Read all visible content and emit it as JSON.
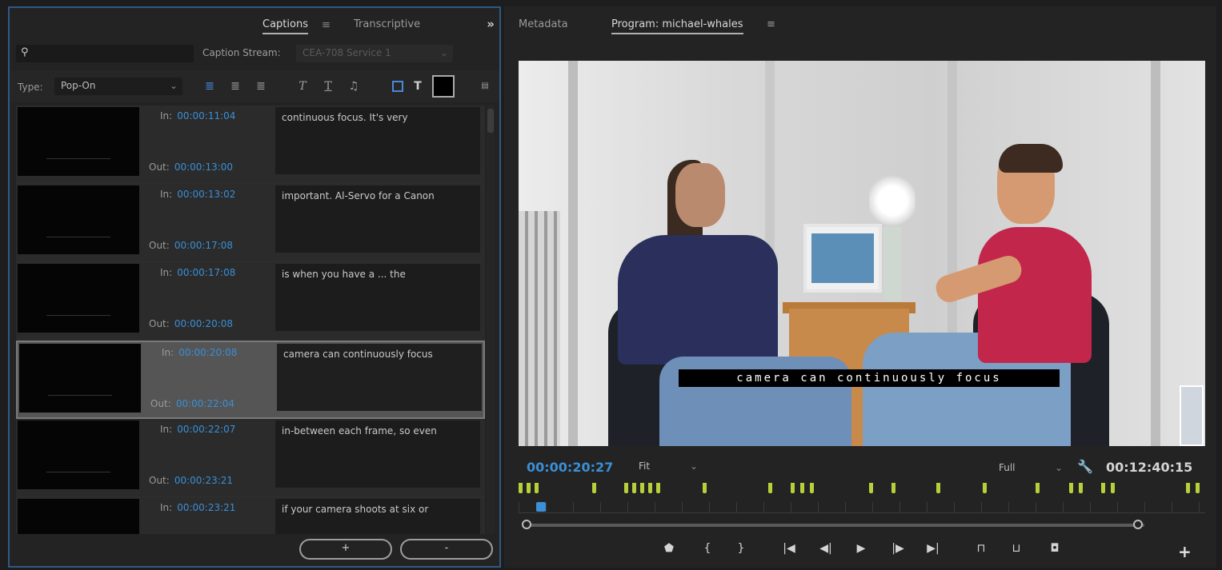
{
  "left_panel": {
    "tabs": [
      {
        "label": "Captions",
        "active": true
      },
      {
        "label": "Transcriptive",
        "active": false
      }
    ],
    "tab_menu_icon": "hamburger-icon",
    "collapse_icon": "double-chevron-right-icon",
    "search": {
      "placeholder": ""
    },
    "caption_stream_label": "Caption Stream:",
    "caption_stream_value": "CEA-708 Service 1",
    "type_label": "Type:",
    "type_value": "Pop-On",
    "toolbar_icons": [
      "align-left-icon",
      "align-center-icon",
      "align-right-icon",
      "italic-icon",
      "underline-icon",
      "music-note-icon",
      "background-color-icon",
      "text-color-icon",
      "color-swatch",
      "safe-margins-icon"
    ],
    "text_style_glyphs": {
      "italic": "T",
      "underline": "T",
      "text_color": "T"
    },
    "swatch_color": "#000000",
    "captions": [
      {
        "in_label": "In:",
        "in": "00:00:11:04",
        "out_label": "Out:",
        "out": "00:00:13:00",
        "text": "continuous focus. It's very",
        "selected": false
      },
      {
        "in_label": "In:",
        "in": "00:00:13:02",
        "out_label": "Out:",
        "out": "00:00:17:08",
        "text": "important. Al-Servo for a Canon",
        "selected": false
      },
      {
        "in_label": "In:",
        "in": "00:00:17:08",
        "out_label": "Out:",
        "out": "00:00:20:08",
        "text": "is when you have a ... the",
        "selected": false
      },
      {
        "in_label": "In:",
        "in": "00:00:20:08",
        "out_label": "Out:",
        "out": "00:00:22:04",
        "text": "camera can continuously focus",
        "selected": true
      },
      {
        "in_label": "In:",
        "in": "00:00:22:07",
        "out_label": "Out:",
        "out": "00:00:23:21",
        "text": "in-between each frame, so even",
        "selected": false
      },
      {
        "in_label": "In:",
        "in": "00:00:23:21",
        "out_label": "Out:",
        "out": "",
        "text": "if your camera shoots at six or",
        "selected": false
      }
    ],
    "add_button": "+",
    "remove_button": "-"
  },
  "right_panel": {
    "tabs": [
      {
        "label": "Metadata",
        "active": false
      },
      {
        "label": "Program: michael-whales",
        "active": true
      }
    ],
    "tab_menu_icon": "hamburger-icon",
    "caption_overlay": "camera can continuously focus",
    "current_timecode": "00:00:20:27",
    "fit_value": "Fit",
    "resolution_value": "Full",
    "wrench_icon": "wrench-icon",
    "duration_timecode": "00:12:40:15",
    "controls": [
      "marker-icon",
      "mark-in-icon",
      "mark-out-icon",
      "go-to-in-icon",
      "step-back-icon",
      "play-icon",
      "step-forward-icon",
      "go-to-out-icon",
      "lift-icon",
      "extract-icon",
      "export-frame-icon"
    ],
    "control_glyphs": [
      "⬟",
      "{",
      "}",
      "|◀",
      "◀|",
      "▶",
      "|▶",
      "▶|",
      "⊓",
      "⊔",
      "◘"
    ],
    "add_button_icon": "plus-icon",
    "add_button_glyph": "+",
    "accent_blue": "#3a8fd6",
    "marker_color": "#b9cf3a"
  }
}
